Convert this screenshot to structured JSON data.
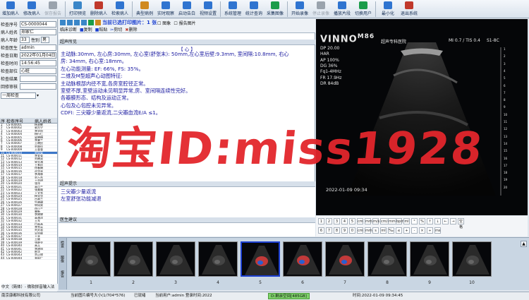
{
  "toolbar": {
    "buttons": [
      {
        "label": "增加病人",
        "icon": "add-patient-icon",
        "color": "#2f74d0",
        "disabled": false
      },
      {
        "label": "修改病人",
        "icon": "edit-patient-icon",
        "color": "#2f74d0",
        "disabled": false
      },
      {
        "label": "保存报告",
        "icon": "save-icon",
        "color": "#9aa3ad",
        "disabled": true
      },
      {
        "label": "打印预览",
        "icon": "print-preview-icon",
        "color": "#3a86c8",
        "disabled": false
      },
      {
        "label": "删除病人",
        "icon": "delete-patient-icon",
        "color": "#c0392b",
        "disabled": false
      },
      {
        "label": "检索病人",
        "icon": "search-patient-icon",
        "color": "#2f74d0",
        "disabled": false
      },
      {
        "label": "典型病例",
        "icon": "case-icon",
        "color": "#d08a1f",
        "disabled": false
      },
      {
        "label": "实时观察",
        "icon": "monitor-icon",
        "color": "#2f74d0",
        "disabled": false
      },
      {
        "label": "启动告白",
        "icon": "alert-icon",
        "color": "#2f74d0",
        "disabled": false
      },
      {
        "label": "视频设置",
        "icon": "video-settings-icon",
        "color": "#2f74d0",
        "disabled": false
      },
      {
        "label": "系统管理",
        "icon": "system-icon",
        "color": "#2f74d0",
        "disabled": false
      },
      {
        "label": "统计查询",
        "icon": "stats-icon",
        "color": "#2f74d0",
        "disabled": false
      },
      {
        "label": "采集图像",
        "icon": "capture-icon",
        "color": "#1b9c4a",
        "disabled": false
      },
      {
        "label": "开始录像",
        "icon": "record-icon",
        "color": "#2f74d0",
        "disabled": false
      },
      {
        "label": "停止录像",
        "icon": "stop-record-icon",
        "color": "#9aa3ad",
        "disabled": true
      },
      {
        "label": "播放片段",
        "icon": "play-clip-icon",
        "color": "#2f74d0",
        "disabled": false
      },
      {
        "label": "切换用户",
        "icon": "switch-user-icon",
        "color": "#1b9c4a",
        "disabled": false
      },
      {
        "label": "最小化",
        "icon": "minimize-icon",
        "color": "#2f74d0",
        "disabled": false
      },
      {
        "label": "退出系统",
        "icon": "exit-icon",
        "color": "#c0392b",
        "disabled": false
      }
    ]
  },
  "patient_form": {
    "fields": [
      {
        "label": "检查序号",
        "value": "CS-0000044"
      },
      {
        "label": "病人姓名",
        "value": "郑家仁"
      },
      {
        "label": "病人年龄",
        "value": "33"
      },
      {
        "label": "检查医生",
        "value": "admin"
      },
      {
        "label": "检查日期",
        "value": "2022年01月04日"
      },
      {
        "label": "检查时间",
        "value": "14:56:45"
      },
      {
        "label": "检查部位",
        "value": "心脏"
      },
      {
        "label": "检查结果",
        "value": ""
      },
      {
        "label": "回修审核",
        "value": ""
      }
    ],
    "sex_label": "性别",
    "sex_value": "男",
    "filter_value": "一周检查"
  },
  "patient_list": {
    "headers": [
      "序号",
      "检查序号",
      "病人姓名"
    ],
    "selected_index": 9,
    "rows": [
      [
        "1",
        "CS-000001",
        "杨淑敏"
      ],
      [
        "2",
        "CS-000002",
        "郭方宁"
      ],
      [
        "3",
        "CS-000003",
        "李学阳"
      ],
      [
        "4",
        "CS-000004",
        "杨行仁"
      ],
      [
        "5",
        "CS-000005",
        "梁晓梅"
      ],
      [
        "6",
        "CS-000006",
        "李爽兰"
      ],
      [
        "7",
        "CS-000007",
        "王晓民"
      ],
      [
        "8",
        "CS-000008",
        "刘惠佳"
      ],
      [
        "9",
        "CS-000009",
        "王蓉蓉"
      ],
      [
        "10",
        "CS-000010",
        "刘宝菊"
      ],
      [
        "11",
        "CS-000011",
        "李爱菊"
      ],
      [
        "12",
        "CS-000012",
        "刘晓双"
      ],
      [
        "13",
        "CS-000013",
        "宋光海"
      ],
      [
        "14",
        "CS-000014",
        "王素珍"
      ],
      [
        "15",
        "CS-000015",
        "徐春娟"
      ],
      [
        "16",
        "CS-000016",
        "孙华亭"
      ],
      [
        "17",
        "CS-000017",
        "李海林"
      ],
      [
        "18",
        "CS-000018",
        "刘万东"
      ],
      [
        "19",
        "CS-000019",
        "王亦明"
      ],
      [
        "20",
        "CS-000020",
        "张萍"
      ],
      [
        "21",
        "CS-000021",
        "高月兰"
      ],
      [
        "22",
        "CS-000022",
        "张美顺"
      ],
      [
        "23",
        "CS-000023",
        "王文秀"
      ],
      [
        "24",
        "CS-000024",
        "杨宝华"
      ],
      [
        "25",
        "CS-000025",
        "吕淑兰"
      ],
      [
        "26",
        "CS-000026",
        "牛晓琳"
      ],
      [
        "27",
        "CS-000027",
        "申凤荣"
      ],
      [
        "28",
        "CS-000028",
        "徐小兰"
      ],
      [
        "29",
        "CS-000029",
        "曹新"
      ],
      [
        "30",
        "CS-000030",
        "李婷婷"
      ],
      [
        "31",
        "CS-000031",
        "高海洋"
      ],
      [
        "32",
        "CS-000032",
        "王军"
      ],
      [
        "33",
        "CS-000033",
        "付晶晶"
      ],
      [
        "34",
        "CS-000034",
        "李秀云"
      ],
      [
        "35",
        "CS-000035",
        "刘文君"
      ],
      [
        "36",
        "CS-000036",
        "吴思维"
      ],
      [
        "37",
        "CS-000037",
        "王亮"
      ],
      [
        "38",
        "CS-000038",
        "王颖"
      ],
      [
        "39",
        "CS-000039",
        "张继业"
      ],
      [
        "40",
        "CS-000040",
        "高玉"
      ],
      [
        "41",
        "CS-000041",
        "李建国"
      ],
      [
        "42",
        "CS-000042",
        "陈华"
      ],
      [
        "43",
        "CS-000043",
        "余正修"
      ],
      [
        "44",
        "CS-000044",
        "郑家仁"
      ]
    ]
  },
  "report": {
    "tab_label": "临床诊断",
    "print_status": "当前已选打印图片：1 张",
    "option1": "图象",
    "option2": "报告图片",
    "btn_copy": "复制",
    "btn_paste": "粘贴",
    "btn_cut": "剪切",
    "btn_delete": "删除",
    "findings_label": "超声所见",
    "findings_title": "【 心 】",
    "findings_lines": [
      "主动脉:30mm, 左心房:30mm, 左心室(舒张末): 50mm,左心室后壁:9.3mm, 室间隔:10.8mm, 右心",
      "房: 34mm, 右心室:18mm。",
      "左心功能测量: EF: 66%, FS: 35%。",
      "二维及M型超声心动图特征:",
      "主动脉根部内径不宽,各房室腔径正常。",
      "室壁不厚,室壁运动未见明显异常,房、室间隔连续性完好。",
      "各瓣膜形态、结构及运动正常。",
      "心包及心包腔未见异常。",
      "CDFI: 三尖瓣少量返流,二尖瓣血流E/A ≤1。"
    ],
    "hint_label": "超声提示",
    "hint_lines": [
      "三尖瓣少量返流",
      "左室舒张功能减退"
    ],
    "advice_label": "医生建议"
  },
  "ultrasound": {
    "brand": "VINNO",
    "model": "M86",
    "hospital": "超声专科医院",
    "mi": "MI 0.7 / TIS 0.4",
    "probe": "S1-8C",
    "params": [
      "DP 20.00",
      "HAR",
      "AP 100%",
      "DG 36%",
      "Fq1-4MHz",
      "FR 17.9Hz",
      "DR 84dB"
    ],
    "timestamp": "2022-01-09 09:34",
    "depth_marks": [
      "1",
      "2",
      "3",
      "4",
      "5",
      "6",
      "7",
      "8",
      "9",
      "10",
      "11",
      "12",
      "13",
      "14",
      "15",
      "16",
      "17",
      "18",
      "19",
      "20"
    ]
  },
  "keypad": {
    "row1": [
      "1",
      "2",
      "3",
      "4",
      "5",
      "cm",
      "mm",
      "m/s",
      "cm/s",
      "mmHg",
      "bpm",
      "ml",
      "°",
      "%",
      "↑",
      "↓",
      "←",
      "→",
      "空格"
    ],
    "row2": [
      "6",
      "7",
      "8",
      "9",
      "0",
      "cm",
      "mm",
      "s",
      "ml",
      "‰",
      "≤",
      "+",
      "-",
      "×",
      "÷",
      "ms"
    ]
  },
  "thumbnails": {
    "labels": [
      "1",
      "2",
      "3",
      "4",
      "5",
      "6",
      "7",
      "8",
      "9",
      "10"
    ],
    "selected_index": 4,
    "side_tabs": [
      "检查",
      "图像",
      "报告"
    ]
  },
  "status": {
    "left": "中文（简体）- 微软拼音输入法",
    "company": "南京康都科技有限公司",
    "image_info": "当前图片编号大小(1/704*576)",
    "ready": "已就绪",
    "user": "当前用户:admin 登录时间:2022",
    "disk": "D:剩余空间[485GB]",
    "time": "时间:2022-01-09 09:34:45"
  },
  "watermark": "淘宝ID:miss1928"
}
